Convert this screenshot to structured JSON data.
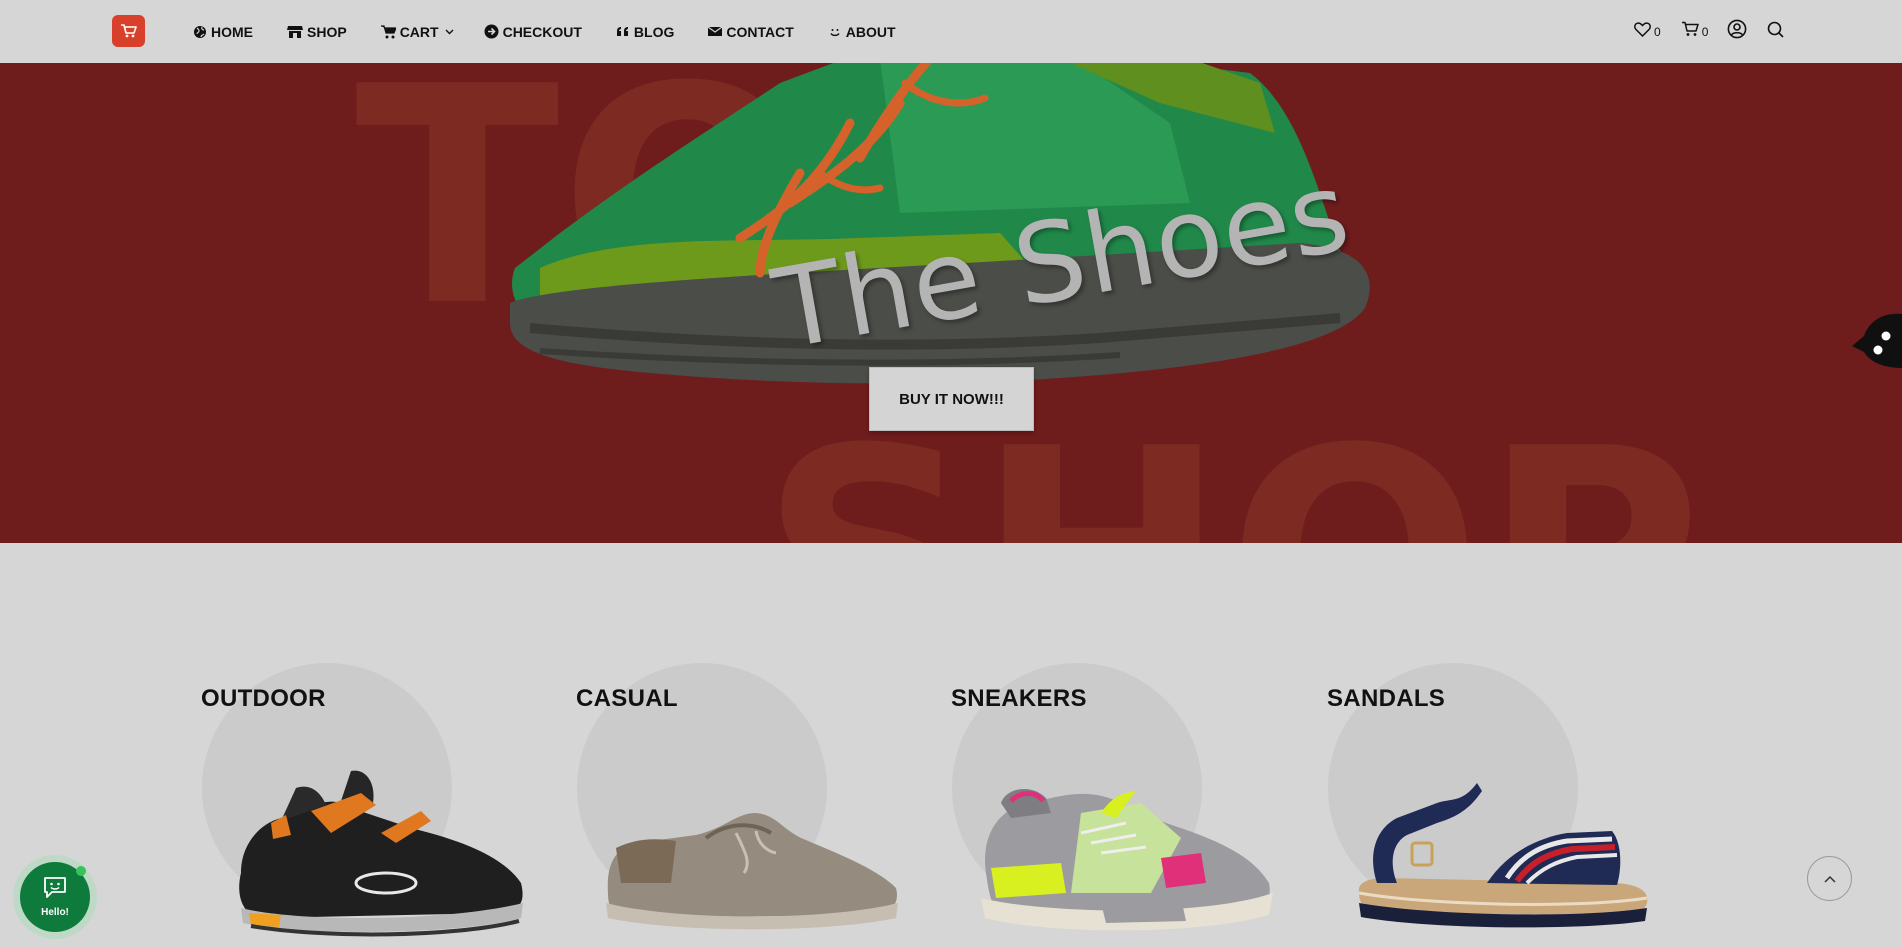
{
  "nav": {
    "items": [
      {
        "label": "HOME",
        "icon": "globe-icon"
      },
      {
        "label": "SHOP",
        "icon": "store-icon"
      },
      {
        "label": "CART",
        "icon": "cart-icon",
        "has_dropdown": true
      },
      {
        "label": "CHECKOUT",
        "icon": "arrow-circle-icon"
      },
      {
        "label": "BLOG",
        "icon": "quote-icon"
      },
      {
        "label": "CONTACT",
        "icon": "envelope-icon"
      },
      {
        "label": "ABOUT",
        "icon": "smile-icon"
      }
    ]
  },
  "header_icons": {
    "wishlist_count": "0",
    "cart_count": "0",
    "icons": [
      "heart-icon",
      "cart-icon",
      "user-icon",
      "search-icon"
    ]
  },
  "hero": {
    "title": "The Shoes",
    "button": "BUY IT NOW!!!",
    "background_words": [
      "TO",
      "SHOP"
    ]
  },
  "categories": [
    {
      "name": "OUTDOOR"
    },
    {
      "name": "CASUAL"
    },
    {
      "name": "SNEAKERS"
    },
    {
      "name": "SANDALS"
    }
  ],
  "chat": {
    "label": "Hello!"
  },
  "colors": {
    "hero_bg": "#6f1c1d",
    "page_bg": "#d6d6d6",
    "logo": "#d9402c",
    "chat": "#0e7a3c"
  }
}
